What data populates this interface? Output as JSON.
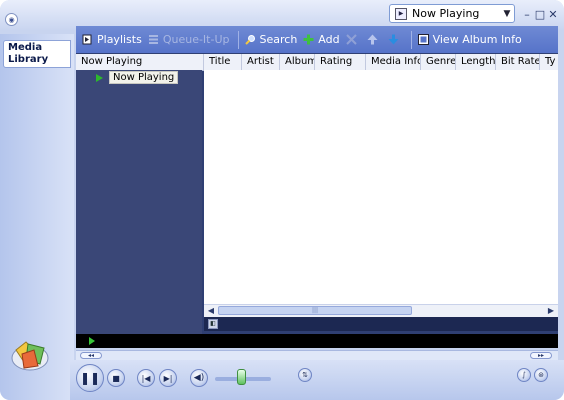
{
  "header": {
    "now_playing_select": "Now Playing",
    "window_controls": [
      "minimize-icon",
      "maximize-icon",
      "close-icon"
    ]
  },
  "sidebar": {
    "tab_line1": "Media",
    "tab_line2": "Library"
  },
  "toolbar": {
    "playlists_label": "Playlists",
    "queue_label": "Queue-It-Up",
    "search_label": "Search",
    "add_label": "Add",
    "view_album_info_label": "View Album Info",
    "icons": [
      "playlists-icon",
      "queue-icon",
      "search-icon",
      "add-icon",
      "delete-icon",
      "move-up-icon",
      "move-down-icon",
      "album-info-icon"
    ]
  },
  "tree": {
    "header": "Now Playing",
    "items": [
      {
        "label": "Now Playing"
      }
    ]
  },
  "list": {
    "columns": [
      "Title",
      "Artist",
      "Album",
      "Rating",
      "Media Info",
      "Genre",
      "Length",
      "Bit Rate",
      "Ty"
    ]
  },
  "colors": {
    "toolbar": "#5673c9",
    "tree": "#3a4777",
    "accent_green": "#2db82d"
  }
}
